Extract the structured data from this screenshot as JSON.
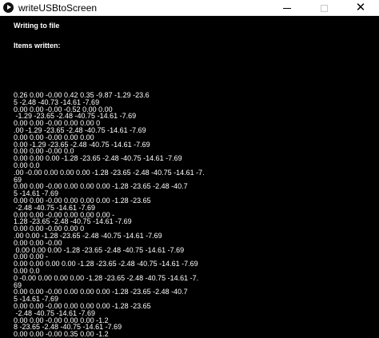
{
  "window": {
    "title": "writeUSBtoScreen",
    "close_glyph": "✕"
  },
  "content": {
    "heading1": "Writing to file",
    "heading2": "Items written:"
  },
  "log_lines": [
    "0.26 0.00 -0.00 0.42 0.35 -9.87 -1.29 -23.6",
    "5 -2.48 -40.73 -14.61 -7.69",
    "0.00 0.00 -0.00 -0.52 0.00 0.00",
    " -1.29 -23.65 -2.48 -40.75 -14.61 -7.69",
    "0.00 0.00 -0.00 0.00 0.00 0",
    ".00 -1.29 -23.65 -2.48 -40.75 -14.61 -7.69",
    "0.00 0.00 -0.00 0.00 0.00",
    "0.00 -1.29 -23.65 -2.48 -40.75 -14.61 -7.69",
    "0.00 0.00 -0.00 0.0",
    "0.00 0.00 0.00 -1.28 -23.65 -2.48 -40.75 -14.61 -7.69",
    "0.00 0.0",
    ".00 -0.00 0.00 0.00 0.00 -1.28 -23.65 -2.48 -40.75 -14.61 -7.",
    "69",
    "0.00 0.00 -0.00 0.00 0.00 0.00 -1.28 -23.65 -2.48 -40.7",
    "5 -14.61 -7.69",
    "0.00 0.00 -0.00 0.00 0.00 0.00 -1.28 -23.65",
    " -2.48 -40.75 -14.61 -7.69",
    "0.00 0.00 -0.00 0.00 0.00 0.00 -",
    "1.28 -23.65 -2.48 -40.75 -14.61 -7.69",
    "0.00 0.00 -0.00 0.00 0",
    ".00 0.00 -1.28 -23.65 -2.48 -40.75 -14.61 -7.69",
    "0.00 0.00 -0.00",
    " 0.00 0.00 0.00 -1.28 -23.65 -2.48 -40.75 -14.61 -7.69",
    "0.00 0.00 -",
    "0.00 0.00 0.00 0.00 -1.28 -23.65 -2.48 -40.75 -14.61 -7.69",
    "0.00 0.0",
    "0 -0.00 0.00 0.00 0.00 -1.28 -23.65 -2.48 -40.75 -14.61 -7.",
    "69",
    "0.00 0.00 -0.00 0.00 0.00 0.00 -1.28 -23.65 -2.48 -40.7",
    "5 -14.61 -7.69",
    "0.00 0.00 -0.00 0.00 0.00 0.00 -1.28 -23.65",
    " -2.48 -40.75 -14.61 -7.69",
    "0.00 0.00 -0.00 0.00 0.00 -1.2",
    "8 -23.65 -2.48 -40.75 -14.61 -7.69",
    "0.00 0.00 -0.00 0.35 0.00 -1.2"
  ]
}
